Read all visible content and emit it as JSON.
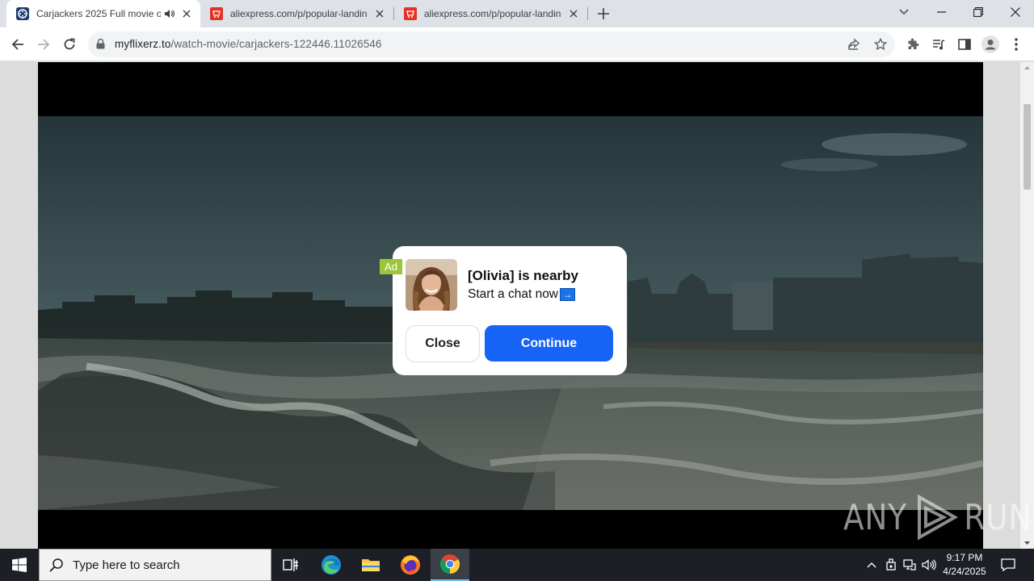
{
  "browser": {
    "tabs": [
      {
        "title": "Carjackers 2025 Full movie o",
        "active": true,
        "audio": true
      },
      {
        "title": "aliexpress.com/p/popular-landin",
        "active": false
      },
      {
        "title": "aliexpress.com/p/popular-landin",
        "active": false
      }
    ],
    "url_host": "myflixerz.to",
    "url_path": "/watch-movie/carjackers-122446.11026546"
  },
  "ad": {
    "badge": "Ad",
    "title": "[Olivia] is nearby",
    "subtitle": "Start a chat now",
    "arrow": "→",
    "close_label": "Close",
    "continue_label": "Continue"
  },
  "watermark": {
    "left": "ANY",
    "right": "RUN"
  },
  "taskbar": {
    "search_placeholder": "Type here to search",
    "time": "9:17 PM",
    "date": "4/24/2025"
  },
  "colors": {
    "continue_button": "#1663f5",
    "ad_badge": "#9dc53a",
    "taskbar": "#1c1f26"
  }
}
